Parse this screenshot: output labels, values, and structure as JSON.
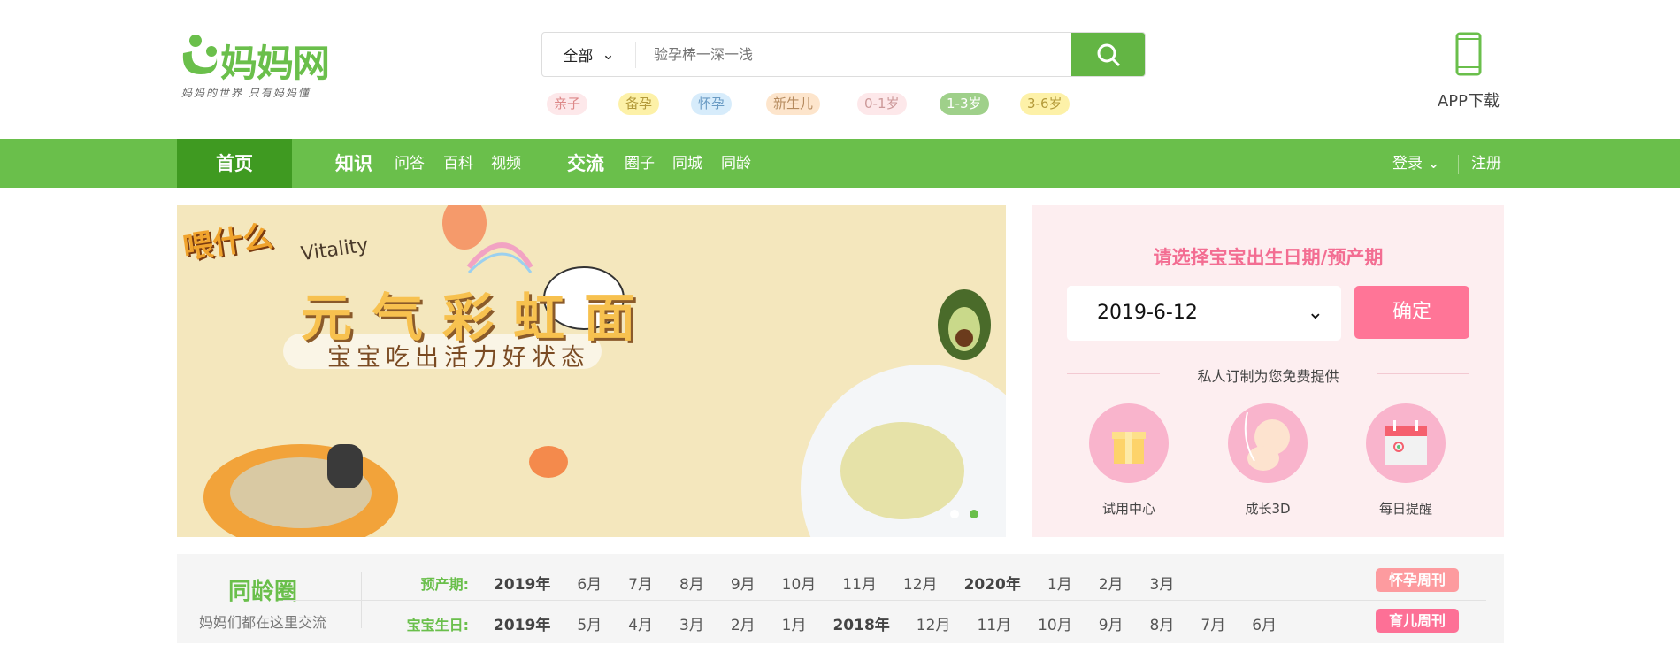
{
  "logo": {
    "name": "妈妈网",
    "slogan": "妈妈的世界 只有妈妈懂"
  },
  "search": {
    "category": "全部",
    "placeholder": "验孕棒一深一浅"
  },
  "tags": [
    {
      "label": "亲子",
      "bg": "#fde8ea",
      "color": "#d88"
    },
    {
      "label": "备孕",
      "bg": "#fdf1a8",
      "color": "#b49a3a"
    },
    {
      "label": "怀孕",
      "bg": "#d7ecfb",
      "color": "#6a9bc4"
    },
    {
      "label": "新生儿",
      "bg": "#fde5cc",
      "color": "#b58a5e"
    },
    {
      "label": "0-1岁",
      "bg": "#fde8ea",
      "color": "#c99"
    },
    {
      "label": "1-3岁",
      "bg": "#9fd08a",
      "color": "#fff"
    },
    {
      "label": "3-6岁",
      "bg": "#fdf1a8",
      "color": "#b49a3a"
    }
  ],
  "app": {
    "label": "APP下载"
  },
  "nav": {
    "home": "首页",
    "knowledge": "知识",
    "qa": "问答",
    "wiki": "百科",
    "video": "视频",
    "community": "交流",
    "circle": "圈子",
    "city": "同城",
    "age": "同龄",
    "login": "登录",
    "register": "注册"
  },
  "banner": {
    "brand": "喂什么",
    "tagline": "Vitality",
    "title": "元气彩虹面",
    "subtitle": "宝宝吃出活力好状态",
    "slides": 2,
    "active_slide": 2
  },
  "panel": {
    "title": "请选择宝宝出生日期/预产期",
    "date": "2019-6-12",
    "confirm": "确定",
    "subtitle": "私人订制为您免费提供",
    "services": [
      {
        "label": "试用中心",
        "icon": "gift-icon"
      },
      {
        "label": "成长3D",
        "icon": "fetus-icon"
      },
      {
        "label": "每日提醒",
        "icon": "calendar-icon"
      }
    ]
  },
  "peers": {
    "title": "同龄圈",
    "subtitle": "妈妈们都在这里交流",
    "due": {
      "label": "预产期:",
      "items": [
        {
          "t": "2019年",
          "y": true
        },
        {
          "t": "6月"
        },
        {
          "t": "7月"
        },
        {
          "t": "8月"
        },
        {
          "t": "9月"
        },
        {
          "t": "10月"
        },
        {
          "t": "11月"
        },
        {
          "t": "12月"
        },
        {
          "t": "2020年",
          "y": true
        },
        {
          "t": "1月"
        },
        {
          "t": "2月"
        },
        {
          "t": "3月"
        }
      ],
      "badge": "怀孕周刊"
    },
    "birth": {
      "label": "宝宝生日:",
      "items": [
        {
          "t": "2019年",
          "y": true
        },
        {
          "t": "5月"
        },
        {
          "t": "4月"
        },
        {
          "t": "3月"
        },
        {
          "t": "2月"
        },
        {
          "t": "1月"
        },
        {
          "t": "2018年",
          "y": true
        },
        {
          "t": "12月"
        },
        {
          "t": "11月"
        },
        {
          "t": "10月"
        },
        {
          "t": "9月"
        },
        {
          "t": "8月"
        },
        {
          "t": "7月"
        },
        {
          "t": "6月"
        }
      ],
      "badge": "育儿周刊"
    }
  },
  "colors": {
    "brand": "#6abf4b",
    "brand_dark": "#3f9a21",
    "pink": "#ff7597"
  }
}
